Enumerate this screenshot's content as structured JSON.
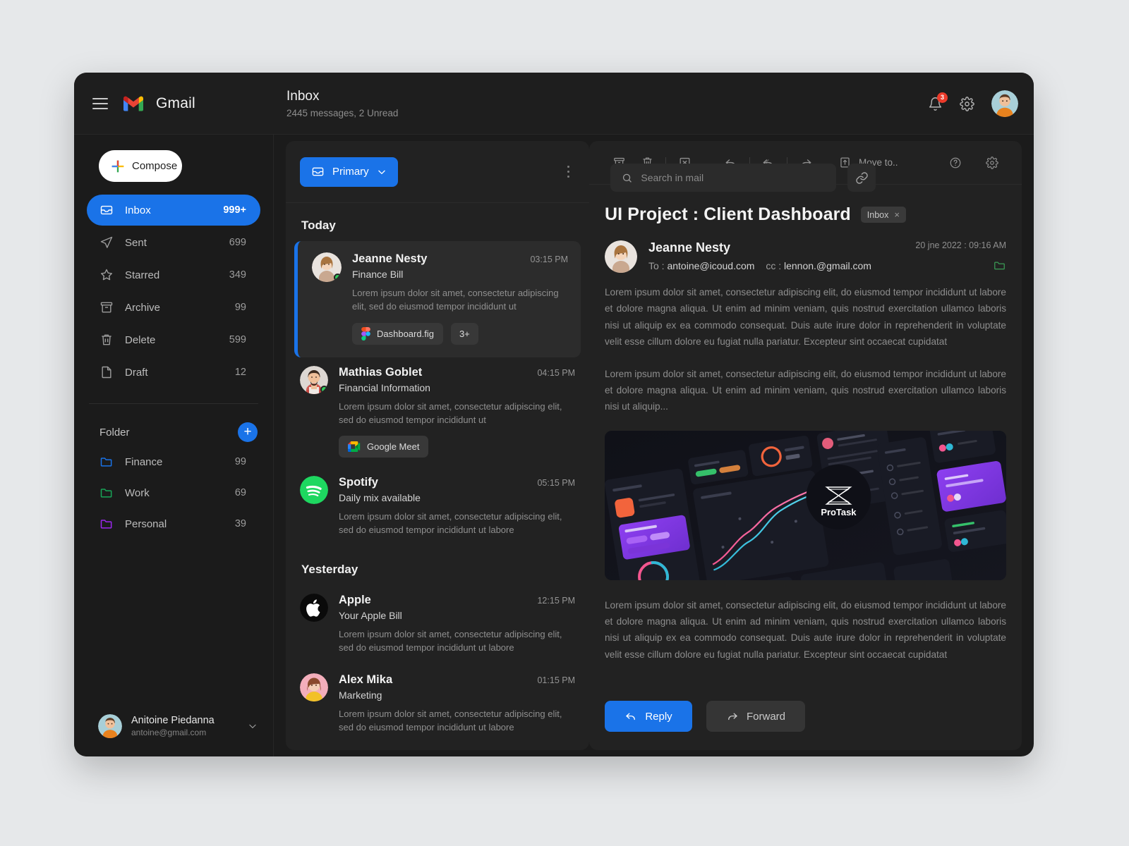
{
  "app": {
    "brand": "Gmail",
    "mailbox_title": "Inbox",
    "mailbox_subtitle": "2445 messages, 2 Unread"
  },
  "search": {
    "placeholder": "Search in mail",
    "value": ""
  },
  "header_icons": {
    "menu": "hamburger-icon",
    "link": "link-icon",
    "bell": "bell-icon",
    "bell_badge": "3",
    "settings": "gear-icon",
    "avatar": "user-avatar"
  },
  "sidebar": {
    "compose_label": "Compose",
    "nav_items": [
      {
        "label": "Inbox",
        "count": "999+",
        "icon": "inbox-icon",
        "active": true
      },
      {
        "label": "Sent",
        "count": "699",
        "icon": "send-icon",
        "active": false
      },
      {
        "label": "Starred",
        "count": "349",
        "icon": "star-icon",
        "active": false
      },
      {
        "label": "Archive",
        "count": "99",
        "icon": "archive-icon",
        "active": false
      },
      {
        "label": "Delete",
        "count": "599",
        "icon": "trash-icon",
        "active": false
      },
      {
        "label": "Draft",
        "count": "12",
        "icon": "file-icon",
        "active": false
      }
    ],
    "folder_header": "Folder",
    "add_folder_label": "+",
    "folders": [
      {
        "label": "Finance",
        "count": "99",
        "color": "#1a73e8"
      },
      {
        "label": "Work",
        "count": "69",
        "color": "#18a558"
      },
      {
        "label": "Personal",
        "count": "39",
        "color": "#9c27f0"
      }
    ],
    "user": {
      "name": "Anitoine Piedanna",
      "email": "antoine@gmail.com"
    }
  },
  "list": {
    "category_label": "Primary",
    "groups": [
      {
        "title": "Today",
        "emails": [
          {
            "name": "Jeanne Nesty",
            "time": "03:15 PM",
            "subject": "Finance Bill",
            "preview": "Lorem ipsum dolor sit amet, consectetur adipiscing elit, sed do eiusmod tempor incididunt ut",
            "selected": true,
            "online": true,
            "avatar_type": "photo-woman-1",
            "chips": [
              {
                "label": "Dashboard.fig",
                "icon": "figma-icon"
              },
              {
                "label": "3+",
                "icon": ""
              }
            ]
          },
          {
            "name": "Mathias Goblet",
            "time": "04:15 PM",
            "subject": "Financial Information",
            "preview": "Lorem ipsum dolor sit amet, consectetur adipiscing elit, sed do eiusmod tempor incididunt ut",
            "selected": false,
            "online": true,
            "avatar_type": "photo-man-1",
            "chips": [
              {
                "label": "Google Meet",
                "icon": "google-meet-icon"
              }
            ]
          },
          {
            "name": "Spotify",
            "time": "05:15 PM",
            "subject": "Daily mix available",
            "preview": "Lorem ipsum dolor sit amet, consectetur adipiscing elit, sed do eiusmod tempor incididunt ut labore",
            "selected": false,
            "online": false,
            "avatar_type": "spotify-logo",
            "chips": []
          }
        ]
      },
      {
        "title": "Yesterday",
        "emails": [
          {
            "name": "Apple",
            "time": "12:15 PM",
            "subject": "Your Apple Bill",
            "preview": "Lorem ipsum dolor sit amet, consectetur adipiscing elit, sed do eiusmod tempor incididunt ut labore",
            "selected": false,
            "online": false,
            "avatar_type": "apple-logo",
            "chips": []
          },
          {
            "name": "Alex Mika",
            "time": "01:15 PM",
            "subject": "Marketing",
            "preview": "Lorem ipsum dolor sit amet, consectetur adipiscing elit, sed do eiusmod tempor incididunt ut labore",
            "selected": false,
            "online": false,
            "avatar_type": "photo-woman-2",
            "chips": []
          }
        ]
      }
    ]
  },
  "detail": {
    "toolbar": {
      "archive": "archive-icon",
      "delete": "trash-icon",
      "spam": "spam-icon",
      "reply": "reply-icon",
      "reply_all": "reply-all-icon",
      "forward": "forward-icon",
      "move_to_label": "Move to..",
      "help": "help-icon",
      "settings": "gear-icon"
    },
    "subject": "UI Project : Client Dashboard",
    "label": "Inbox",
    "label_close": "×",
    "sender_name": "Jeanne Nesty",
    "to_label": "To :",
    "to_address": "antoine@icoud.com",
    "cc_label": "cc :",
    "cc_address": "lennon.@gmail.com",
    "date": "20 jne 2022 : 09:16 AM",
    "paragraph_1": "Lorem ipsum dolor sit amet, consectetur adipiscing elit,  do eiusmod tempor incididunt ut labore et dolore magna aliqua. Ut enim ad minim veniam, quis nostrud exercitation ullamco laboris nisi ut aliquip ex ea commodo consequat. Duis aute irure dolor in reprehenderit in voluptate velit esse cillum dolore eu fugiat nulla pariatur. Excepteur sint occaecat cupidatat",
    "paragraph_2": "Lorem ipsum dolor sit amet, consectetur adipiscing elit,  do eiusmod tempor incididunt ut labore et dolore magna aliqua. Ut enim ad minim veniam, quis nostrud exercitation ullamco laboris nisi ut aliquip...",
    "paragraph_3": "Lorem ipsum dolor sit amet, consectetur adipiscing elit,  do eiusmod tempor incididunt ut labore et dolore magna aliqua. Ut enim ad minim veniam, quis nostrud exercitation ullamco laboris nisi ut aliquip ex ea commodo consequat. Duis aute irure dolor in reprehenderit in voluptate velit esse cillum dolore eu fugiat nulla pariatur. Excepteur sint occaecat cupidatat",
    "embedded_image_label": "ProTask",
    "reply_button": "Reply",
    "forward_button": "Forward"
  },
  "colors": {
    "accent": "#1a73e8",
    "window_bg": "#1b1b1b",
    "panel_bg": "#222222",
    "page_bg": "#e6e8ea",
    "badge_red": "#ec3b2b",
    "online_green": "#2fcc5a",
    "spotify_green": "#1ed760"
  }
}
